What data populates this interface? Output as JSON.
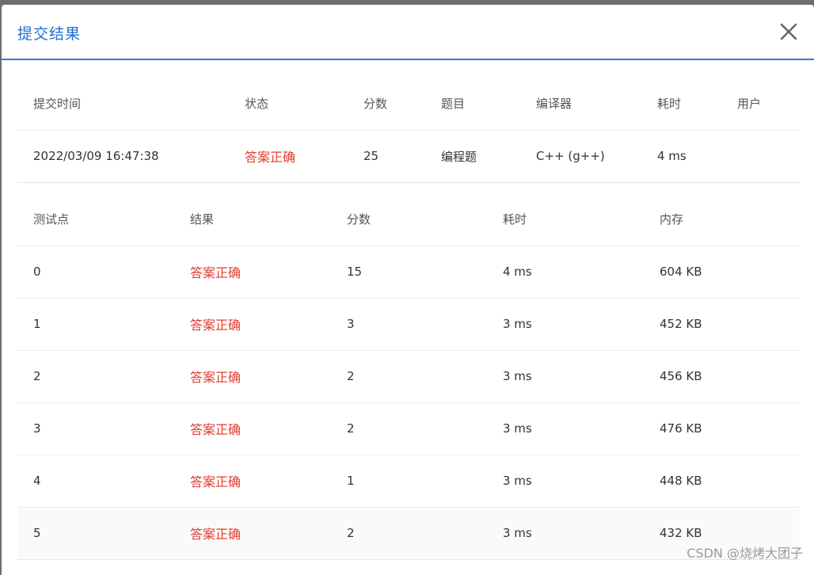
{
  "dialog": {
    "title": "提交结果"
  },
  "summary": {
    "headers": [
      "提交时间",
      "状态",
      "分数",
      "题目",
      "编译器",
      "耗时",
      "用户"
    ],
    "row": {
      "time": "2022/03/09 16:47:38",
      "status": "答案正确",
      "score": "25",
      "problem": "编程题",
      "compiler": "C++ (g++)",
      "elapsed": "4 ms",
      "user": ""
    }
  },
  "tests": {
    "headers": [
      "测试点",
      "结果",
      "分数",
      "耗时",
      "内存"
    ],
    "rows": [
      {
        "id": "0",
        "result": "答案正确",
        "score": "15",
        "time": "4 ms",
        "memory": "604 KB"
      },
      {
        "id": "1",
        "result": "答案正确",
        "score": "3",
        "time": "3 ms",
        "memory": "452 KB"
      },
      {
        "id": "2",
        "result": "答案正确",
        "score": "2",
        "time": "3 ms",
        "memory": "456 KB"
      },
      {
        "id": "3",
        "result": "答案正确",
        "score": "2",
        "time": "3 ms",
        "memory": "476 KB"
      },
      {
        "id": "4",
        "result": "答案正确",
        "score": "1",
        "time": "3 ms",
        "memory": "448 KB"
      },
      {
        "id": "5",
        "result": "答案正确",
        "score": "2",
        "time": "3 ms",
        "memory": "432 KB"
      }
    ]
  },
  "watermark": "CSDN @烧烤大团子",
  "colors": {
    "accent": "#1f6fd1",
    "status_ok": "#e33b2e",
    "backdrop": "#6d6d6d"
  },
  "icons": {
    "close": "close-icon"
  }
}
